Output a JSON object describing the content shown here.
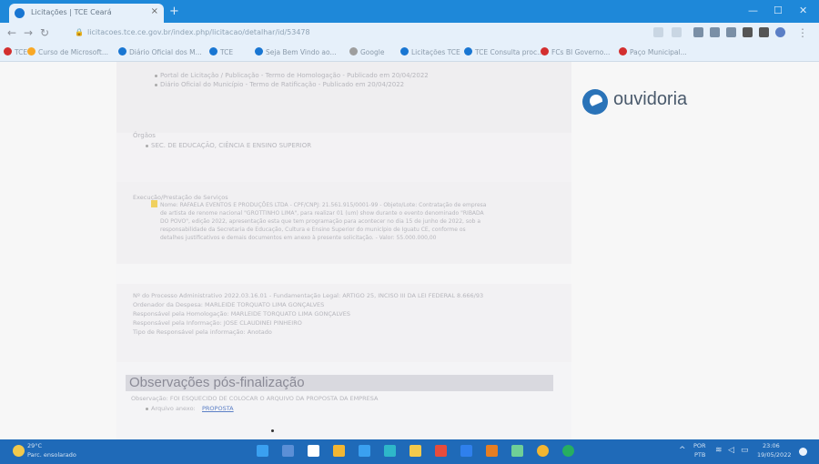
{
  "browser": {
    "tab_title": "Licitações | TCE Ceará",
    "new_tab": "+",
    "url": "licitacoes.tce.ce.gov.br/index.php/licitacao/detalhar/id/53478",
    "bookmarks": [
      {
        "label": "TCE",
        "color": "#d32f2f"
      },
      {
        "label": "Curso de Microsoft...",
        "color": "#f9a825"
      },
      {
        "label": "Diário Oficial dos M...",
        "color": "#1976d2"
      },
      {
        "label": "TCE",
        "color": "#1976d2"
      },
      {
        "label": "Seja Bem Vindo ao...",
        "color": "#1976d2"
      },
      {
        "label": "Google",
        "color": "#9e9e9e"
      },
      {
        "label": "Licitações TCE",
        "color": "#1976d2"
      },
      {
        "label": "TCE Consulta proc...",
        "color": "#1976d2"
      },
      {
        "label": "FCs BI Governo...",
        "color": "#d32f2f"
      },
      {
        "label": "Paço Municipal...",
        "color": "#d32f2f"
      }
    ]
  },
  "content": {
    "top_lines": [
      "Portal de Licitação / Publicação - Termo de Homologação - Publicado em 20/04/2022",
      "Diário Oficial do Município - Termo de Ratificação - Publicado em 20/04/2022"
    ],
    "orgaos_label": "Órgãos",
    "orgaos_item": "SEC. DE EDUCAÇÃO, CIÊNCIA E ENSINO SUPERIOR",
    "execucao_label": "Execução/Prestação de Serviços",
    "execucao_text": [
      "Nome: RAFAELA EVENTOS E PRODUÇÕES LTDA - CPF/CNPJ: 21.561.915/0001-99 - Objeto/Lote: Contratação de empresa",
      "de artista de renome nacional \"GROTTINHO LIMA\", para realizar 01 (um) show durante o evento denominado \"RIBADA",
      "DO POVO\", edição 2022, apresentação esta que tem programação para acontecer no dia 15 de junho de 2022, sob a",
      "responsabilidade da Secretaria de Educação, Cultura e Ensino Superior do município de Iguatu CE, conforme os",
      "detalhes justificativos e demais documentos em anexo à presente solicitação. - Valor: 55.000.000,00"
    ],
    "processo_lines": [
      "Nº do Processo Administrativo 2022.03.16.01 - Fundamentação Legal: ARTIGO 25, INCISO III DA LEI FEDERAL 8.666/93",
      "Ordenador da Despesa: MARLEIDE TORQUATO LIMA GONÇALVES",
      "Responsável pela Homologação: MARLEIDE TORQUATO LIMA GONÇALVES",
      "Responsável pela Informação: JOSE CLAUDINEI PINHEIRO",
      "Tipo de Responsável pela informação: Anotado"
    ],
    "obs_title": "Observações pós-finalização",
    "obs_text": "Observação: FOI ESQUECIDO DE COLOCAR O ARQUIVO DA PROPOSTA DA EMPRESA",
    "obs_attachment_label": "Arquivo anexo:",
    "obs_attachment_link": "PROPOSTA"
  },
  "logo": {
    "text": "ouvidoria"
  },
  "taskbar": {
    "weather": "29°C",
    "weather_sub": "Parc. ensolarado",
    "lang": "POR",
    "lang_sub": "PTB",
    "time": "23:06",
    "date": "19/05/2022",
    "icon_colors": [
      "#3aa0f0",
      "#5b8fd6",
      "#ffffff",
      "#f2b632",
      "#3aa0f0",
      "#2eb7c9",
      "#f2c94c",
      "#e74c3c",
      "#2f80ed",
      "#e67e22",
      "#6fcf97",
      "#f2b632",
      "#27ae60"
    ]
  }
}
